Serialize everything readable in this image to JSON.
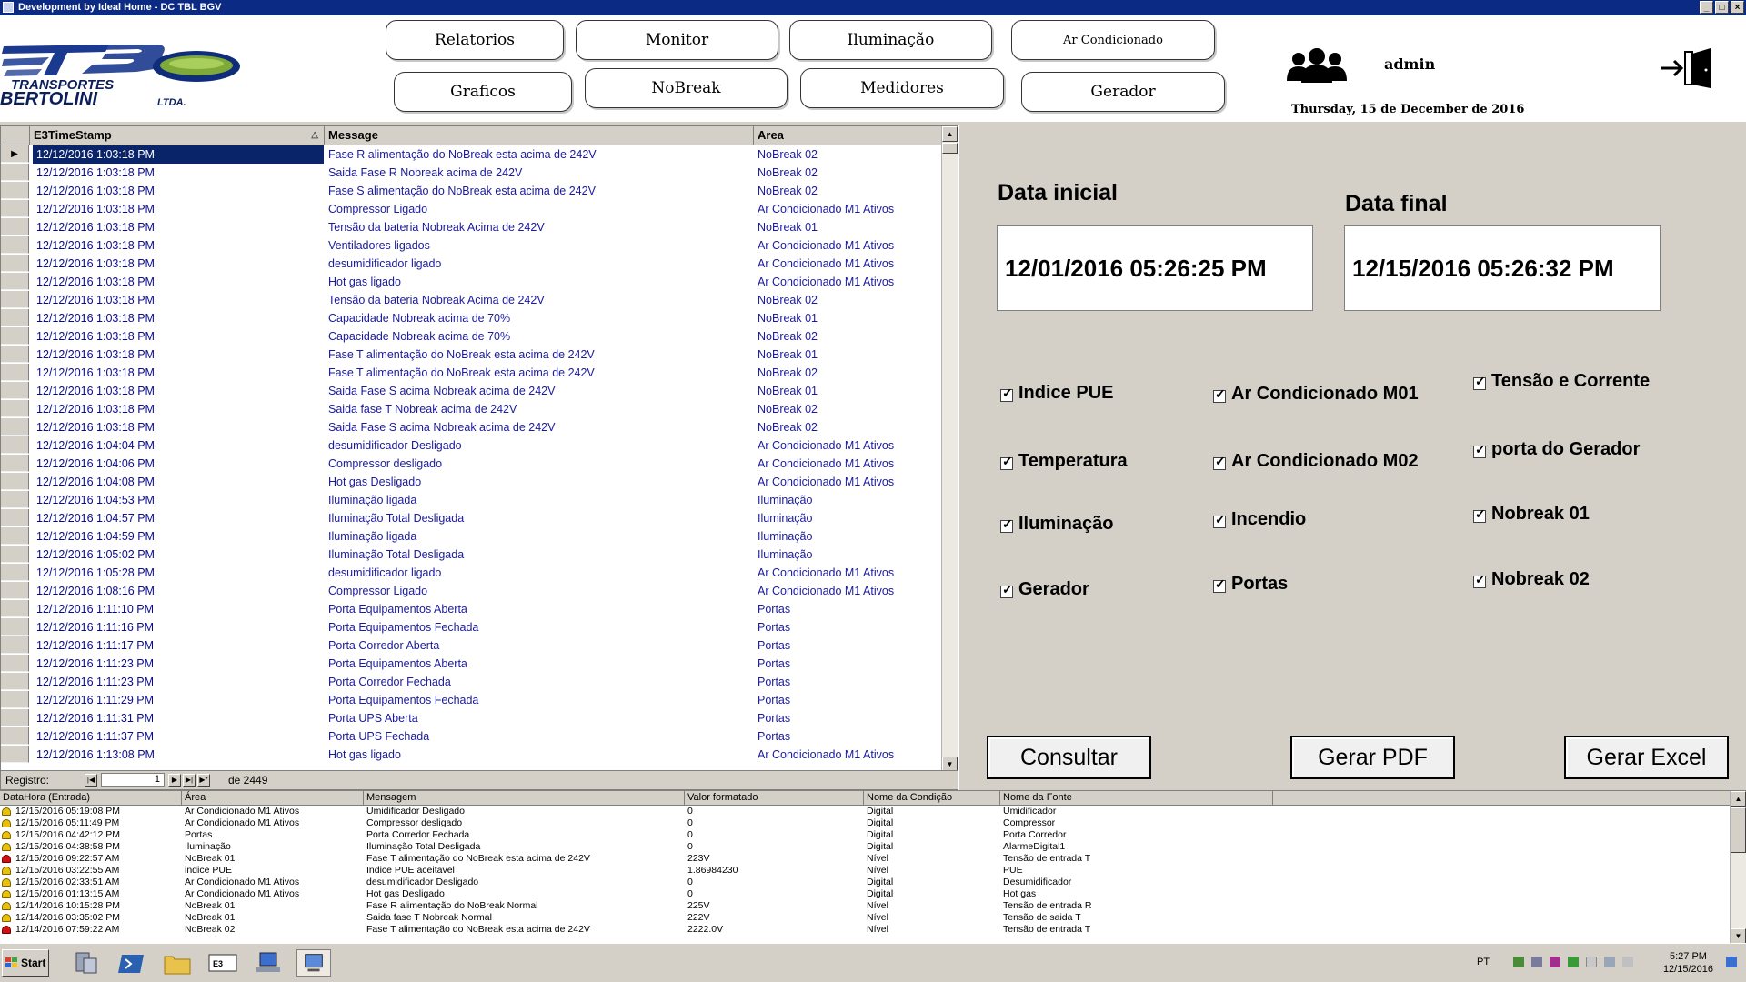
{
  "window": {
    "title": "Development by Ideal Home - DC TBL BGV",
    "controls": [
      "_",
      "□",
      "×"
    ]
  },
  "logo": {
    "line1": "TRANSPORTES",
    "line2": "BERTOLINI",
    "line3": "LTDA.",
    "brand_color": "#1b3a8f",
    "accent_color": "#7faa3a"
  },
  "nav": {
    "relatorios": "Relatorios",
    "monitor": "Monitor",
    "iluminacao": "Iluminação",
    "ar_condicionado": "Ar Condicionado",
    "graficos": "Graficos",
    "nobreak": "NoBreak",
    "medidores": "Medidores",
    "gerador": "Gerador"
  },
  "user": {
    "name": "admin",
    "date": "Thursday, 15  de December de 2016"
  },
  "grid": {
    "columns": [
      "E3TimeStamp",
      "Message",
      "Area"
    ],
    "rows": [
      [
        "12/12/2016 1:03:18 PM",
        "Fase R alimentação do NoBreak  esta acima de 242V",
        "NoBreak 02"
      ],
      [
        "12/12/2016 1:03:18 PM",
        "Saida Fase R Nobreak acima de 242V",
        "NoBreak 02"
      ],
      [
        "12/12/2016 1:03:18 PM",
        "Fase S  alimentação do NoBreak  esta acima de 242V",
        "NoBreak 02"
      ],
      [
        "12/12/2016 1:03:18 PM",
        "Compressor Ligado",
        "Ar Condicionado M1 Ativos"
      ],
      [
        "12/12/2016 1:03:18 PM",
        "Tensão da bateria Nobreak Acima de 242V",
        "NoBreak 01"
      ],
      [
        "12/12/2016 1:03:18 PM",
        "Ventiladores ligados",
        "Ar Condicionado M1 Ativos"
      ],
      [
        "12/12/2016 1:03:18 PM",
        "desumidificador ligado",
        "Ar Condicionado M1 Ativos"
      ],
      [
        "12/12/2016 1:03:18 PM",
        "Hot gas ligado",
        "Ar Condicionado M1 Ativos"
      ],
      [
        "12/12/2016 1:03:18 PM",
        "Tensão da bateria Nobreak Acima de 242V",
        "NoBreak 02"
      ],
      [
        "12/12/2016 1:03:18 PM",
        "Capacidade Nobreak acima de 70%",
        "NoBreak 01"
      ],
      [
        "12/12/2016 1:03:18 PM",
        "Capacidade Nobreak acima de 70%",
        "NoBreak 02"
      ],
      [
        "12/12/2016 1:03:18 PM",
        "Fase T alimentação do NoBreak  esta acima de 242V",
        "NoBreak 01"
      ],
      [
        "12/12/2016 1:03:18 PM",
        "Fase T alimentação do NoBreak  esta acima de 242V",
        "NoBreak 02"
      ],
      [
        "12/12/2016 1:03:18 PM",
        "Saida Fase S acima Nobreak acima de 242V",
        "NoBreak 01"
      ],
      [
        "12/12/2016 1:03:18 PM",
        "Saida fase T Nobreak acima de 242V",
        "NoBreak 02"
      ],
      [
        "12/12/2016 1:03:18 PM",
        "Saida Fase S acima Nobreak acima de 242V",
        "NoBreak 02"
      ],
      [
        "12/12/2016 1:04:04 PM",
        "desumidificador Desligado",
        "Ar Condicionado M1 Ativos"
      ],
      [
        "12/12/2016 1:04:06 PM",
        "Compressor desligado",
        "Ar Condicionado M1 Ativos"
      ],
      [
        "12/12/2016 1:04:08 PM",
        "Hot gas Desligado",
        "Ar Condicionado M1 Ativos"
      ],
      [
        "12/12/2016 1:04:53 PM",
        "Iluminação ligada",
        "Iluminação"
      ],
      [
        "12/12/2016 1:04:57 PM",
        "Iluminação Total Desligada",
        "Iluminação"
      ],
      [
        "12/12/2016 1:04:59 PM",
        "Iluminação ligada",
        "Iluminação"
      ],
      [
        "12/12/2016 1:05:02 PM",
        "Iluminação Total Desligada",
        "Iluminação"
      ],
      [
        "12/12/2016 1:05:28 PM",
        "desumidificador ligado",
        "Ar Condicionado M1 Ativos"
      ],
      [
        "12/12/2016 1:08:16 PM",
        "Compressor Ligado",
        "Ar Condicionado M1 Ativos"
      ],
      [
        "12/12/2016 1:11:10 PM",
        "Porta Equipamentos Aberta",
        "Portas"
      ],
      [
        "12/12/2016 1:11:16 PM",
        "Porta Equipamentos Fechada",
        "Portas"
      ],
      [
        "12/12/2016 1:11:17 PM",
        "Porta Corredor Aberta",
        "Portas"
      ],
      [
        "12/12/2016 1:11:23 PM",
        "Porta Equipamentos Aberta",
        "Portas"
      ],
      [
        "12/12/2016 1:11:23 PM",
        "Porta Corredor Fechada",
        "Portas"
      ],
      [
        "12/12/2016 1:11:29 PM",
        "Porta Equipamentos Fechada",
        "Portas"
      ],
      [
        "12/12/2016 1:11:31 PM",
        "Porta UPS Aberta",
        "Portas"
      ],
      [
        "12/12/2016 1:11:37 PM",
        "Porta UPS Fechada",
        "Portas"
      ],
      [
        "12/12/2016 1:13:08 PM",
        "Hot gas ligado",
        "Ar Condicionado M1 Ativos"
      ]
    ],
    "footer": {
      "label": "Registro:",
      "current": "1",
      "of": "de 2449"
    }
  },
  "filters": {
    "data_inicial_label": "Data inicial",
    "data_final_label": "Data final",
    "data_inicial": "12/01/2016 05:26:25 PM",
    "data_final": "12/15/2016 05:26:32 PM",
    "checkboxes": [
      "Indice PUE",
      "Ar Condicionado M01",
      "Tensão e Corrente",
      "Temperatura",
      "Ar Condicionado M02",
      "porta do Gerador",
      "Iluminação",
      "Incendio",
      "Nobreak 01",
      "Gerador",
      "Portas",
      "Nobreak 02"
    ],
    "buttons": {
      "consultar": "Consultar",
      "gerar_pdf": "Gerar PDF",
      "gerar_excel": "Gerar Excel"
    }
  },
  "alarms": {
    "columns": [
      "DataHora (Entrada)",
      "Área",
      "Mensagem",
      "Valor formatado",
      "Nome da Condição",
      "Nome da Fonte"
    ],
    "rows": [
      {
        "severity": "yellow",
        "cells": [
          "12/15/2016 05:19:08 PM",
          "Ar Condicionado M1 Ativos",
          "Umidificador Desligado",
          "0",
          "Digital",
          "Umidificador"
        ]
      },
      {
        "severity": "yellow",
        "cells": [
          "12/15/2016 05:11:49 PM",
          "Ar Condicionado M1 Ativos",
          "Compressor desligado",
          "0",
          "Digital",
          "Compressor"
        ]
      },
      {
        "severity": "yellow",
        "cells": [
          "12/15/2016 04:42:12 PM",
          "Portas",
          "Porta Corredor Fechada",
          "0",
          "Digital",
          "Porta Corredor"
        ]
      },
      {
        "severity": "yellow",
        "cells": [
          "12/15/2016 04:38:58 PM",
          "Iluminação",
          "Iluminação Total Desligada",
          "0",
          "Digital",
          "AlarmeDigital1"
        ]
      },
      {
        "severity": "red",
        "cells": [
          "12/15/2016 09:22:57 AM",
          "NoBreak 01",
          "Fase T alimentação do NoBreak  esta acima de 242V",
          "223V",
          "Nível",
          "Tensão de entrada T"
        ]
      },
      {
        "severity": "yellow",
        "cells": [
          "12/15/2016 03:22:55 AM",
          "indice PUE",
          "Indice PUE aceitavel",
          "1.86984230",
          "Nível",
          "PUE"
        ]
      },
      {
        "severity": "yellow",
        "cells": [
          "12/15/2016 02:33:51 AM",
          "Ar Condicionado M1 Ativos",
          "desumidificador Desligado",
          "0",
          "Digital",
          "Desumidificador"
        ]
      },
      {
        "severity": "yellow",
        "cells": [
          "12/15/2016 01:13:15 AM",
          "Ar Condicionado M1 Ativos",
          "Hot gas Desligado",
          "0",
          "Digital",
          "Hot gas"
        ]
      },
      {
        "severity": "yellow",
        "cells": [
          "12/14/2016 10:15:28 PM",
          "NoBreak 01",
          "Fase R alimentação do NoBreak  Normal",
          "225V",
          "Nível",
          "Tensão de entrada R"
        ]
      },
      {
        "severity": "yellow",
        "cells": [
          "12/14/2016 03:35:02 PM",
          "NoBreak 01",
          "Saida fase T Nobreak Normal",
          "222V",
          "Nível",
          "Tensão de saida T"
        ]
      },
      {
        "severity": "red",
        "cells": [
          "12/14/2016 07:59:22 AM",
          "NoBreak 02",
          "Fase T alimentação do NoBreak  esta acima de 242V",
          "2222.0V",
          "Nível",
          "Tensão de entrada T"
        ]
      }
    ]
  },
  "taskbar": {
    "start": "Start",
    "lang": "PT",
    "time": "5:27 PM",
    "date": "12/15/2016"
  }
}
